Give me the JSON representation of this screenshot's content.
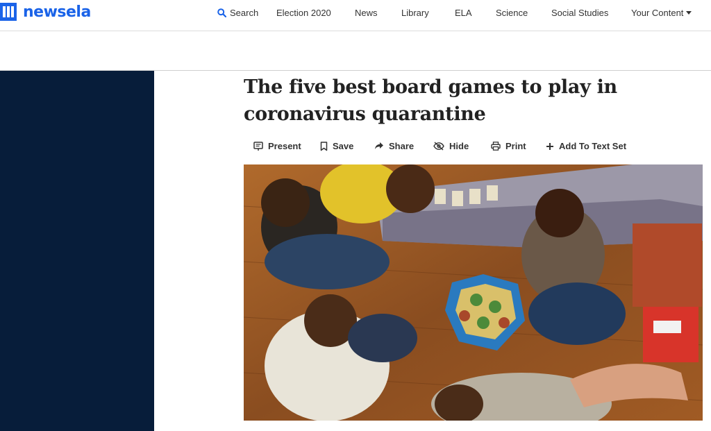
{
  "brand": {
    "name": "newsela",
    "color": "#1a63e8",
    "logo_icon": "newsela-logo-icon"
  },
  "nav": {
    "search_label": "Search",
    "items": [
      {
        "label": "Election 2020"
      },
      {
        "label": "News"
      },
      {
        "label": "Library"
      },
      {
        "label": "ELA"
      },
      {
        "label": "Science"
      },
      {
        "label": "Social Studies"
      }
    ],
    "your_content_label": "Your Content"
  },
  "article": {
    "title_line1": "The five best board games to play in",
    "title_line2": "coronavirus quarantine",
    "toolbar": {
      "present": "Present",
      "save": "Save",
      "share": "Share",
      "hide": "Hide",
      "print": "Print",
      "add_to_text_set": "Add To Text Set"
    },
    "hero_image": "photo-teens-playing-board-game-on-floor"
  },
  "colors": {
    "sidebar": "#071d3a",
    "accent": "#1a63e8"
  }
}
